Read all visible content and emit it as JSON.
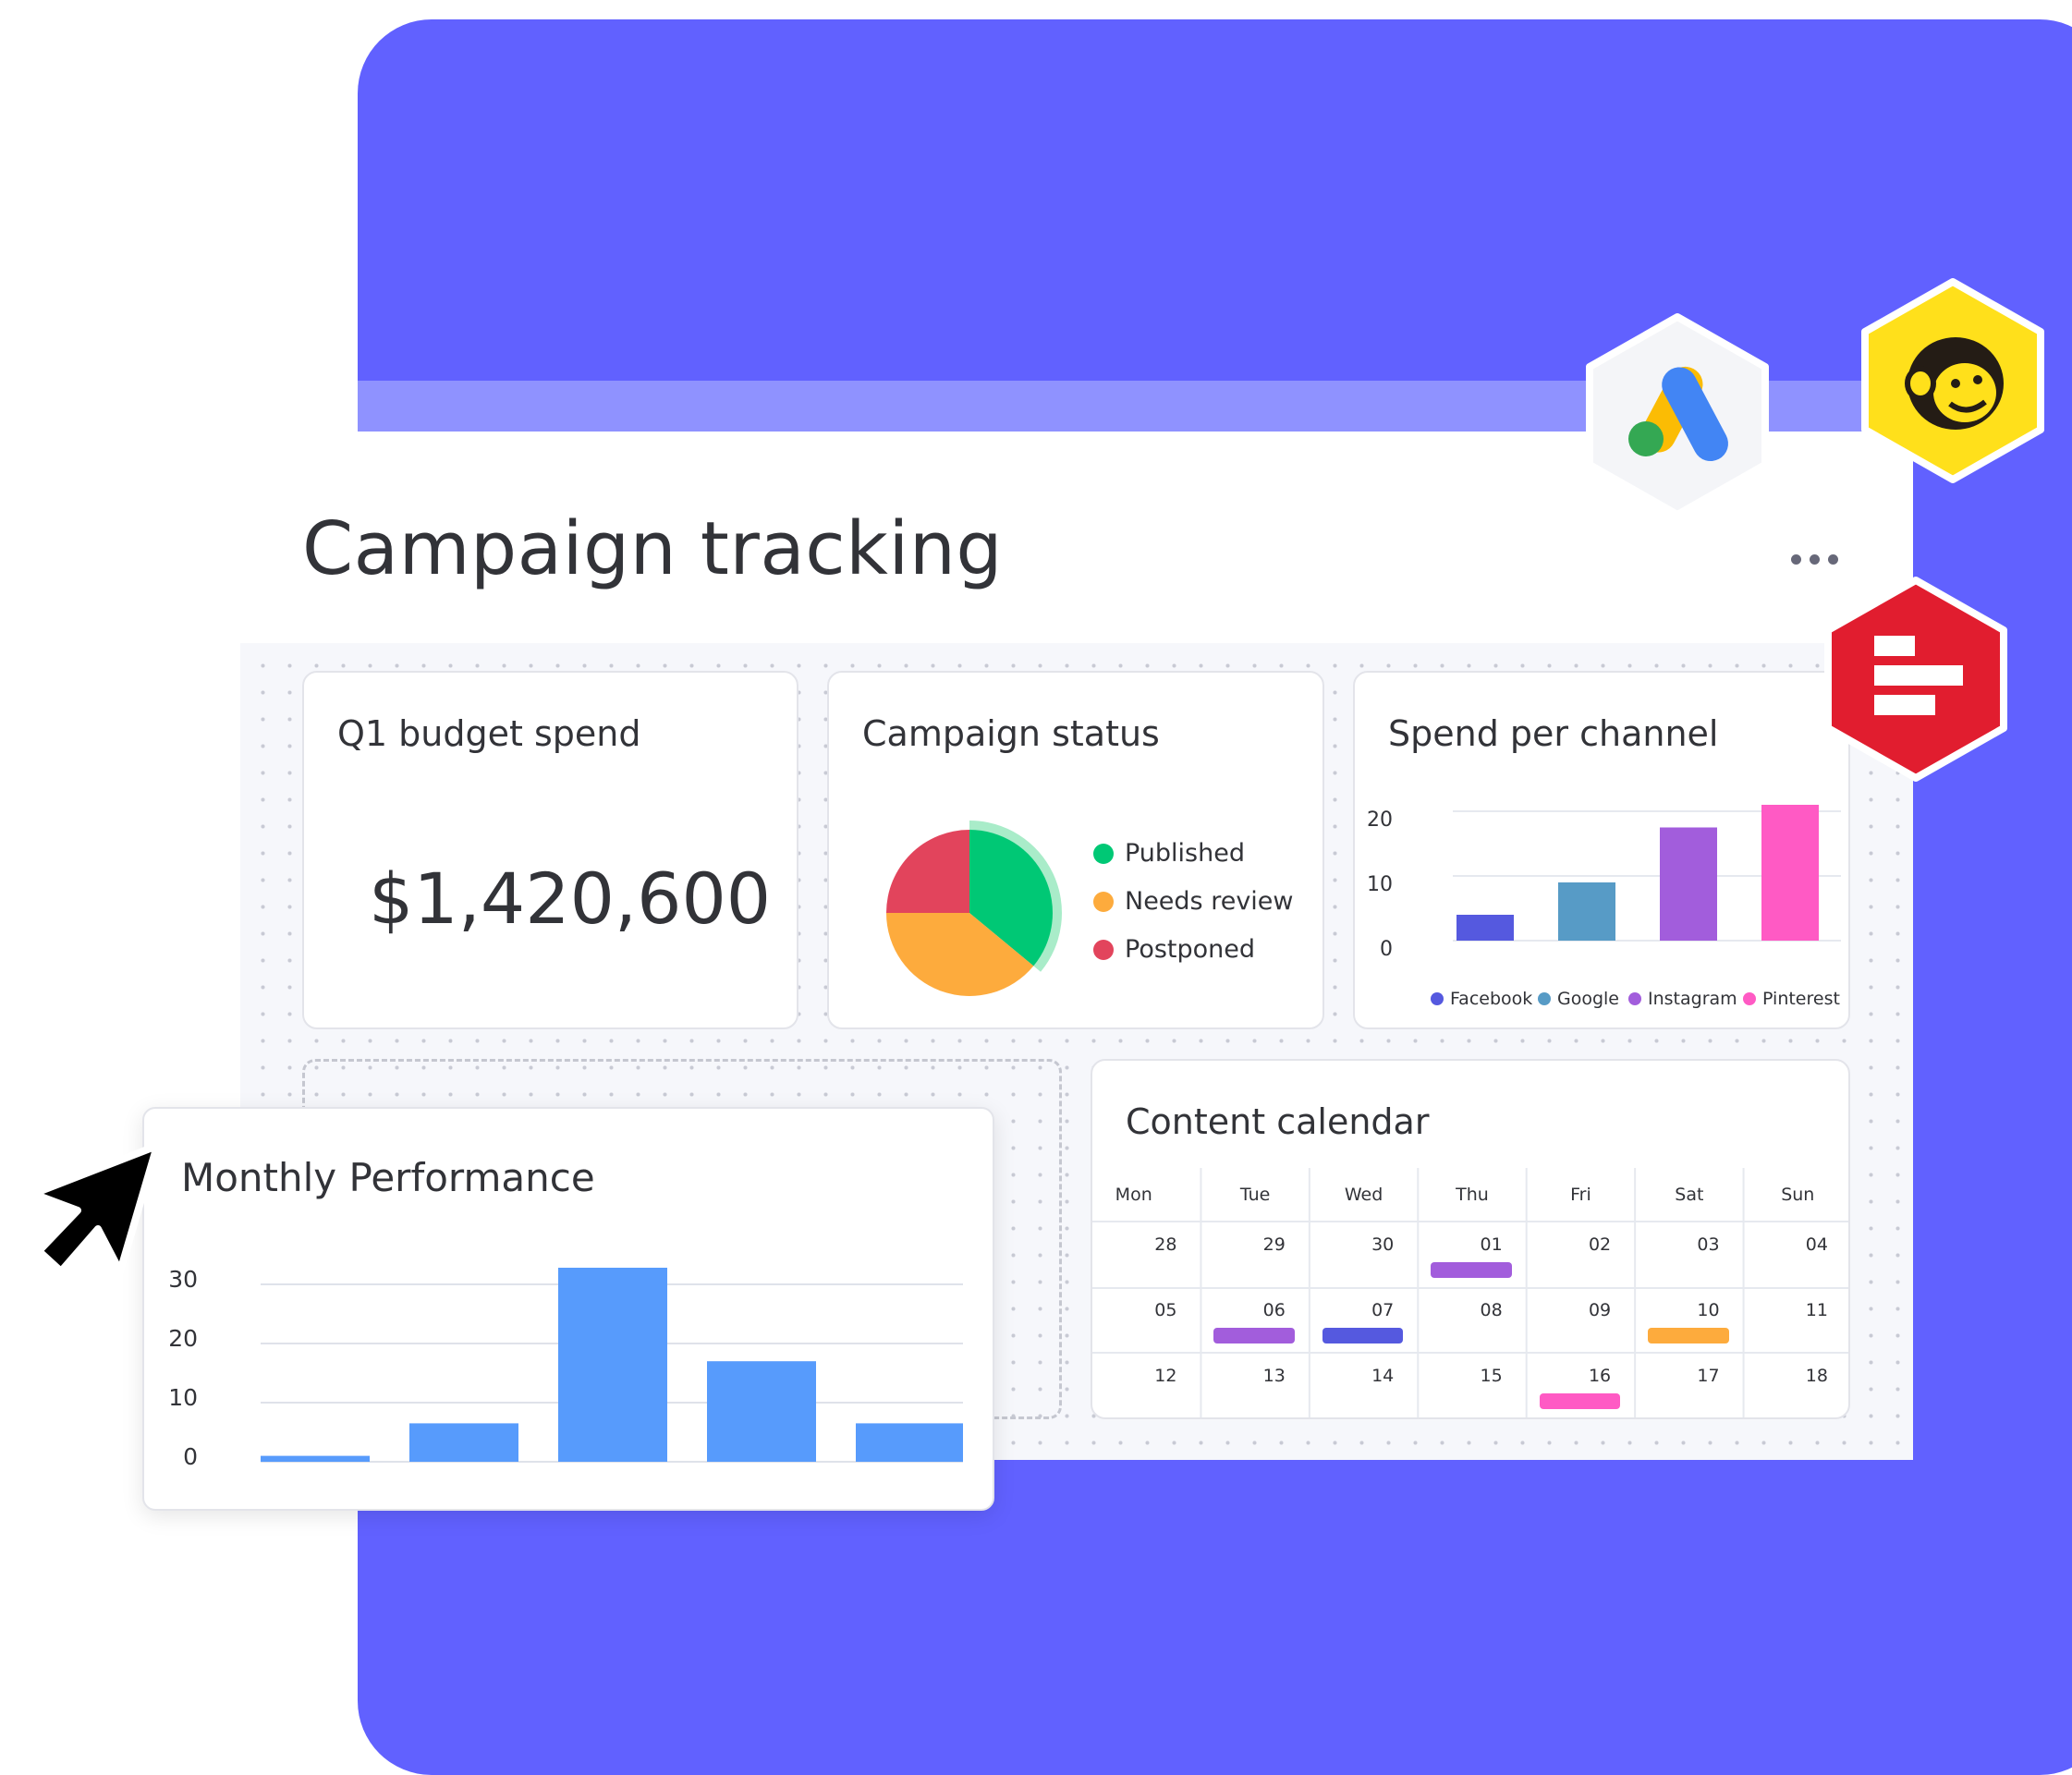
{
  "board": {
    "title": "Campaign tracking",
    "menu_icon": "more-horizontal-icon"
  },
  "integrations": [
    {
      "name": "google-ads-icon"
    },
    {
      "name": "mailchimp-icon"
    },
    {
      "name": "red-app-icon"
    }
  ],
  "budget_card": {
    "title": "Q1 budget spend",
    "value": "$1,420,600"
  },
  "status_card": {
    "title": "Campaign status",
    "legend": [
      {
        "label": "Published",
        "color": "#00c875"
      },
      {
        "label": "Needs review",
        "color": "#fdab3d"
      },
      {
        "label": "Postponed",
        "color": "#e2445c"
      }
    ]
  },
  "channel_card": {
    "title": "Spend per channel",
    "y_ticks": [
      "20",
      "10",
      "0"
    ],
    "legend": [
      {
        "label": "Facebook",
        "color": "#5559df"
      },
      {
        "label": "Google",
        "color": "#579bc6"
      },
      {
        "label": "Instagram",
        "color": "#a25ddc"
      },
      {
        "label": "Pinterest",
        "color": "#ff5ac4"
      }
    ]
  },
  "calendar_card": {
    "title": "Content calendar",
    "days": [
      "Mon",
      "Tue",
      "Wed",
      "Thu",
      "Fri",
      "Sat",
      "Sun"
    ],
    "weeks": [
      [
        "28",
        "29",
        "30",
        "01",
        "02",
        "03",
        "04"
      ],
      [
        "05",
        "06",
        "07",
        "08",
        "09",
        "10",
        "11"
      ],
      [
        "12",
        "13",
        "14",
        "15",
        "16",
        "17",
        "18"
      ]
    ],
    "events": [
      {
        "week": 0,
        "day": 3,
        "color": "#a25ddc"
      },
      {
        "week": 1,
        "day": 1,
        "color": "#a25ddc"
      },
      {
        "week": 1,
        "day": 2,
        "color": "#5559df"
      },
      {
        "week": 1,
        "day": 5,
        "color": "#fdab3d"
      },
      {
        "week": 2,
        "day": 4,
        "color": "#ff5ac4"
      }
    ]
  },
  "performance_card": {
    "title": "Monthly Performance",
    "y_ticks": [
      "30",
      "20",
      "10",
      "0"
    ]
  },
  "cursor": {
    "name": "cursor-arrow-icon"
  },
  "chart_data": [
    {
      "type": "pie",
      "title": "Campaign status",
      "categories": [
        "Published",
        "Needs review",
        "Postponed"
      ],
      "values": [
        36,
        39,
        25
      ],
      "colors": [
        "#00c875",
        "#fdab3d",
        "#e2445c"
      ]
    },
    {
      "type": "bar",
      "title": "Spend per channel",
      "categories": [
        "Facebook",
        "Google",
        "Instagram",
        "Pinterest"
      ],
      "values": [
        4,
        9,
        17.5,
        21
      ],
      "colors": [
        "#5559df",
        "#579bc6",
        "#a25ddc",
        "#ff5ac4"
      ],
      "ylim": [
        0,
        20
      ],
      "grid": true,
      "legend": "bottom"
    },
    {
      "type": "bar",
      "title": "Monthly Performance",
      "categories": [
        "",
        "",
        "",
        "",
        ""
      ],
      "values": [
        1,
        6.5,
        33,
        17,
        6.5
      ],
      "color": "#579bfc",
      "ylim": [
        0,
        30
      ],
      "grid": true
    }
  ]
}
